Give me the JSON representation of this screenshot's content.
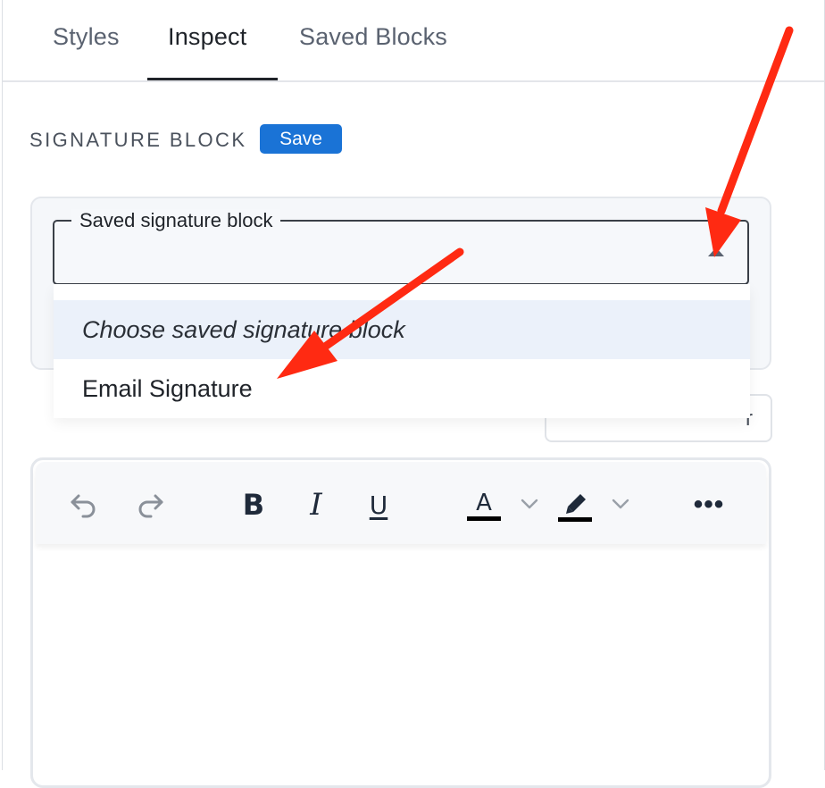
{
  "tabs": [
    {
      "label": "Styles"
    },
    {
      "label": "Inspect"
    },
    {
      "label": "Saved Blocks"
    }
  ],
  "section": {
    "title": "SIGNATURE BLOCK",
    "save_label": "Save"
  },
  "select": {
    "legend": "Saved signature block",
    "options": [
      {
        "label": "Choose saved signature block"
      },
      {
        "label": "Email Signature"
      }
    ]
  },
  "hidden_button": {
    "label_fragment": "r"
  },
  "toolbar": {
    "bold": "B",
    "italic": "I",
    "underline": "U",
    "text_color": "A",
    "more": "•••"
  },
  "colors": {
    "accent": "#1a73d6",
    "annotation": "#ff2a12",
    "selected_option_bg": "#ebf1fa"
  },
  "icons": [
    "undo-icon",
    "redo-icon",
    "chevron-down-icon",
    "highlighter-icon",
    "more-icon",
    "caret-up-icon"
  ]
}
